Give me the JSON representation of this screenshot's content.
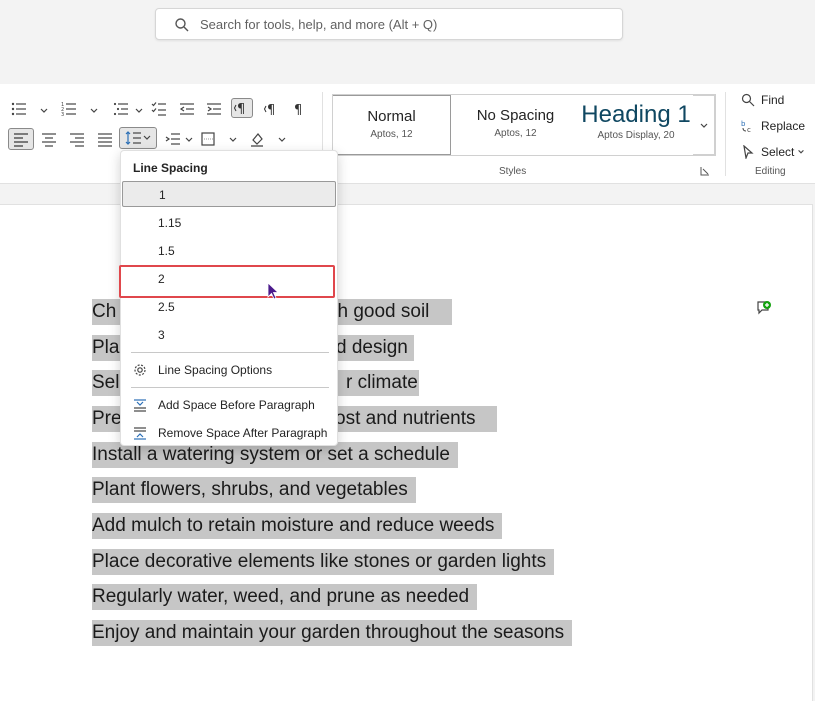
{
  "search": {
    "placeholder": "Search for tools, help, and more (Alt + Q)"
  },
  "styles": {
    "group_label": "Styles",
    "items": [
      {
        "name": "Normal",
        "font": "Aptos, 12"
      },
      {
        "name": "No Spacing",
        "font": "Aptos, 12"
      },
      {
        "name": "Heading 1",
        "font": "Aptos Display, 20"
      }
    ]
  },
  "editing": {
    "group_label": "Editing",
    "find": "Find",
    "replace": "Replace",
    "select": "Select"
  },
  "line_spacing_menu": {
    "title": "Line Spacing",
    "options": [
      "1",
      "1.15",
      "1.5",
      "2",
      "2.5",
      "3"
    ],
    "current": "1",
    "highlighted": "2",
    "actions": [
      "Line Spacing Options",
      "Add Space Before Paragraph",
      "Remove Space After Paragraph"
    ]
  },
  "document": {
    "paragraphs": [
      "Ch",
      "Pla",
      "Sel",
      "Pre",
      "Install a watering system or set a schedule",
      "Plant flowers, shrubs, and vegetables",
      "Add mulch to retain moisture and reduce weeds",
      "Place decorative elements like stones or garden lights",
      "Regularly water, weed, and prune as needed",
      "Enjoy and maintain your garden throughout the seasons"
    ],
    "visible_fragments": [
      "ith good soil",
      "d design",
      "r climate",
      "ost and nutrients"
    ]
  },
  "colors": {
    "accent_heading": "#0f4761",
    "highlight_border": "#e0474c",
    "selection": "#c6c6c6",
    "cursor": "#4b1a8c"
  }
}
